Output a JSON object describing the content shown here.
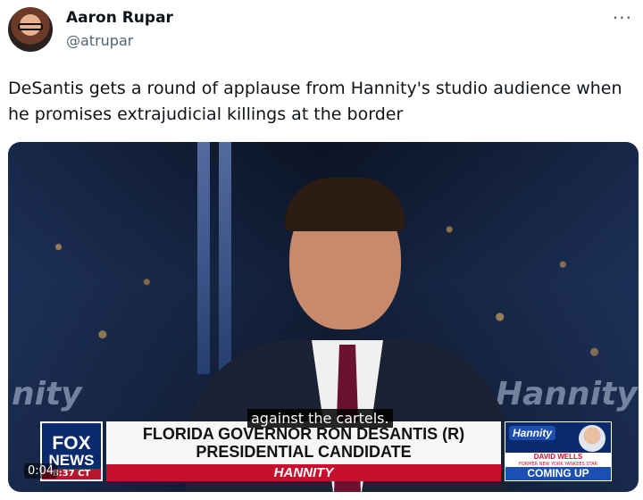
{
  "author": {
    "name": "Aaron Rupar",
    "handle": "@atrupar"
  },
  "more_menu": {
    "label": "···"
  },
  "tweet": {
    "text": "DeSantis gets a round of applause from Hannity's studio audience when he promises extrajudicial killings at the border"
  },
  "video": {
    "caption": "against the cartels.",
    "time": "0:04",
    "background_text_left": "nity",
    "background_text_right": "Hannity",
    "lower_third": {
      "logo_line1": "FOX",
      "logo_line2": "NEWS",
      "logo_time": "8:37 CT",
      "headline_line1": "FLORIDA GOVERNOR RON DESANTIS (R)",
      "headline_line2": "PRESIDENTIAL CANDIDATE",
      "show_name": "HANNITY",
      "promo_logo": "Hannity",
      "promo_name": "DAVID WELLS",
      "promo_subtitle": "FORMER NEW YORK YANKEES STAR",
      "promo_cta": "COMING UP"
    }
  }
}
